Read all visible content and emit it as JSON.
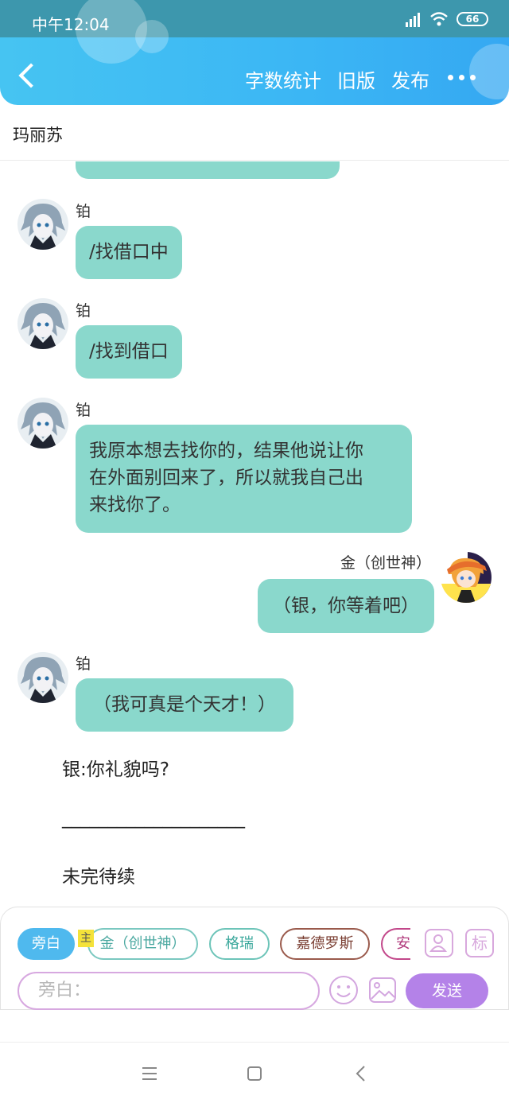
{
  "status_bar": {
    "time": "中午12:04",
    "battery": "66"
  },
  "header": {
    "actions": [
      "字数统计",
      "旧版",
      "发布"
    ]
  },
  "title": "玛丽苏",
  "messages": [
    {
      "sender": "铂",
      "text": "/找借口中"
    },
    {
      "sender": "铂",
      "text": "/找到借口"
    },
    {
      "sender": "铂",
      "lines": [
        "我原本想去找你的，结果他说让你",
        "在外面别回来了，所以就我自己出",
        "来找你了。"
      ]
    },
    {
      "sender": "金（创世神）",
      "text": "（银，你等着吧）"
    },
    {
      "sender": "铂",
      "text": "（我可真是个天才！）"
    }
  ],
  "narration": [
    "银:你礼貌吗?",
    "____________________",
    "未完待续"
  ],
  "composer": {
    "chips": [
      "旁白",
      "金（创世神）",
      "格瑞",
      "嘉德罗斯",
      "安"
    ],
    "owner_tag": "主",
    "tag_icon": "标",
    "input_placeholder": "旁白：",
    "send": "发送"
  },
  "colors": {
    "accent": "#3bb6f4",
    "bubble": "#8ad8cc",
    "send": "#b482e8"
  }
}
